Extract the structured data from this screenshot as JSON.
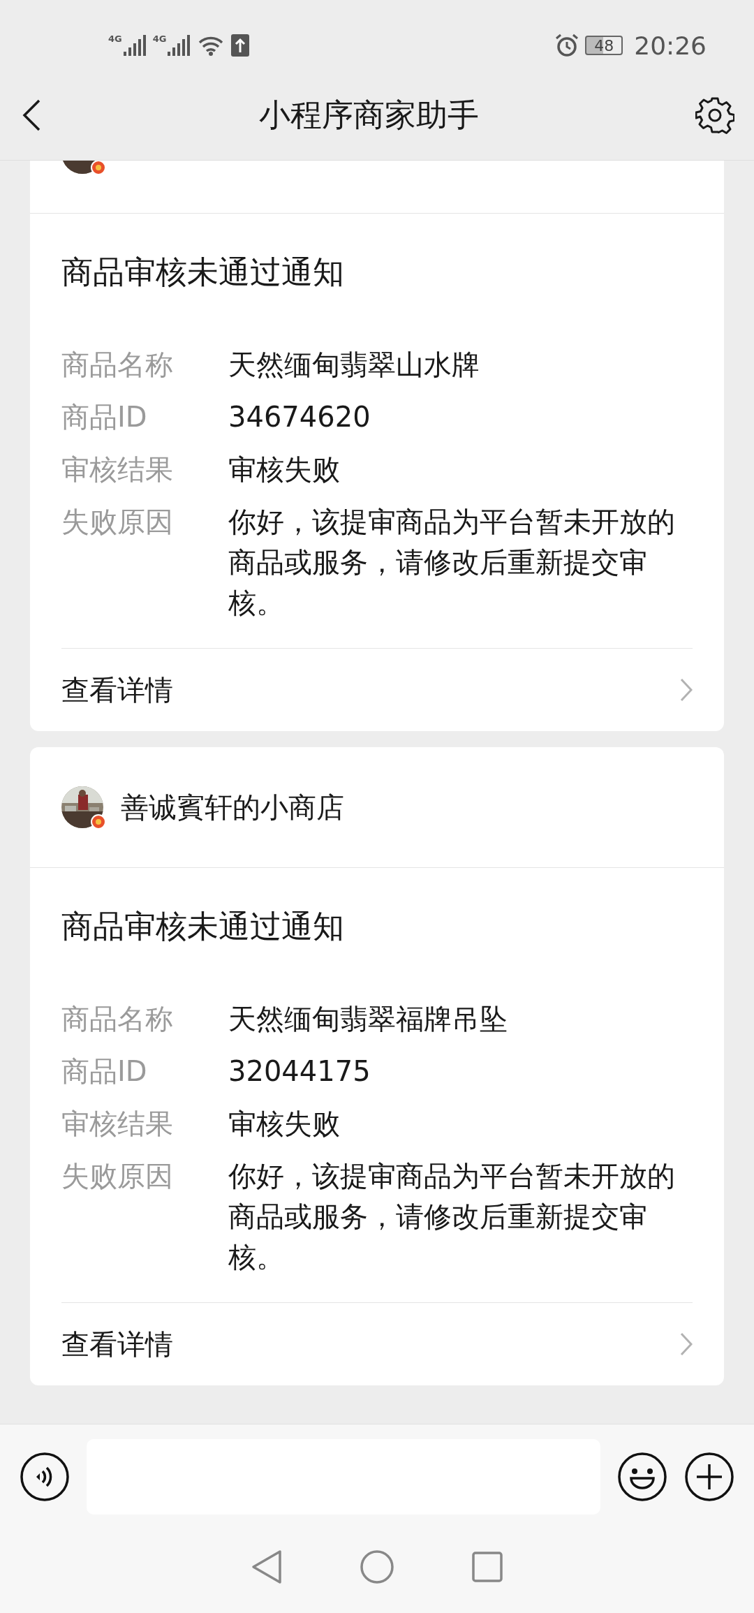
{
  "status_bar": {
    "networks": [
      "4G",
      "4G"
    ],
    "battery": "48",
    "time": "20:26"
  },
  "nav": {
    "title": "小程序商家助手"
  },
  "cards": [
    {
      "title": "商品审核未通过通知",
      "fields": [
        {
          "label": "商品名称",
          "value": "天然缅甸翡翠山水牌"
        },
        {
          "label": "商品ID",
          "value": "34674620"
        },
        {
          "label": "审核结果",
          "value": "审核失败"
        },
        {
          "label": "失败原因",
          "value": "你好，该提审商品为平台暂未开放的商品或服务，请修改后重新提交审核。"
        }
      ],
      "link": "查看详情"
    },
    {
      "shop": "善诚賓轩的小商店",
      "title": "商品审核未通过通知",
      "fields": [
        {
          "label": "商品名称",
          "value": "天然缅甸翡翠福牌吊坠"
        },
        {
          "label": "商品ID",
          "value": "32044175"
        },
        {
          "label": "审核结果",
          "value": "审核失败"
        },
        {
          "label": "失败原因",
          "value": "你好，该提审商品为平台暂未开放的商品或服务，请修改后重新提交审核。"
        }
      ],
      "link": "查看详情"
    }
  ]
}
